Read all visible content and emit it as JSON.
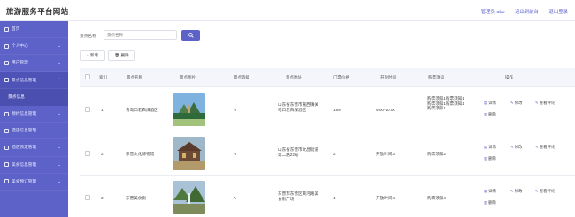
{
  "header": {
    "site_title": "旅游服务平台网站",
    "links": [
      "管理员 abo",
      "退出到前台",
      "退出登录"
    ]
  },
  "sidebar": {
    "items": [
      {
        "label": "首页",
        "icon": "home-icon",
        "has_chevron": false
      },
      {
        "label": "个人中心",
        "icon": "user-icon",
        "has_chevron": true
      },
      {
        "label": "用户管理",
        "icon": "users-icon",
        "has_chevron": true
      },
      {
        "label": "景点信息管理",
        "icon": "map-icon",
        "has_chevron": true,
        "open": true
      },
      {
        "label": "景点信息",
        "submenu": true
      },
      {
        "label": "预约信息管理",
        "icon": "calendar-icon",
        "has_chevron": true
      },
      {
        "label": "酒店信息管理",
        "icon": "hotel-icon",
        "has_chevron": true
      },
      {
        "label": "酒店预定管理",
        "icon": "booking-icon",
        "has_chevron": true
      },
      {
        "label": "美食信息管理",
        "icon": "food-icon",
        "has_chevron": true
      },
      {
        "label": "美食预订管理",
        "icon": "order-icon",
        "has_chevron": true
      }
    ]
  },
  "search": {
    "label": "景点名称",
    "placeholder": "景点名称",
    "button_icon": "search-icon"
  },
  "toolbar": {
    "add_label": "+ 新增",
    "delete_label": "删除"
  },
  "table": {
    "columns": [
      "索引",
      "景点名称",
      "景点图片",
      "景点等级",
      "景点地址",
      "门票价格",
      "开放时间",
      "购票须知",
      "操作"
    ],
    "rows": [
      {
        "index": "1",
        "name": "青岛口老白煤酒区",
        "level": "A",
        "address": "山东省东营市嘉西镇关司口老白煤酒区",
        "price": "199",
        "open_time": "9:00-10:00",
        "notes": "购票须知1购票须知1购票须知1购票须知1购票须知1",
        "actions": [
          "详情",
          "修改",
          "查看评论",
          "删除"
        ],
        "image_colors": [
          "#7fb2df",
          "#2f6b3a",
          "#a3c27c"
        ]
      },
      {
        "index": "2",
        "name": "东营文化博物馆",
        "level": "A",
        "address": "山东省东营市文昌街道第二路22号",
        "price": "2",
        "open_time": "开放时间3",
        "notes": "购票须知2",
        "actions": [
          "详情",
          "修改",
          "查看评论",
          "删除"
        ],
        "image_colors": [
          "#9fb8c9",
          "#6b4a36",
          "#b39a6a"
        ]
      },
      {
        "index": "3",
        "name": "东营美食街",
        "level": "A",
        "address": "东营市东营区黄河路美食街广场",
        "price": "4",
        "open_time": "开放时间4",
        "notes": "购票须知4",
        "actions": [
          "详情",
          "修改",
          "查看评论",
          "删除"
        ],
        "image_colors": [
          "#a9c2d6",
          "#4f7a3f",
          "#7d8c5a"
        ]
      }
    ]
  }
}
